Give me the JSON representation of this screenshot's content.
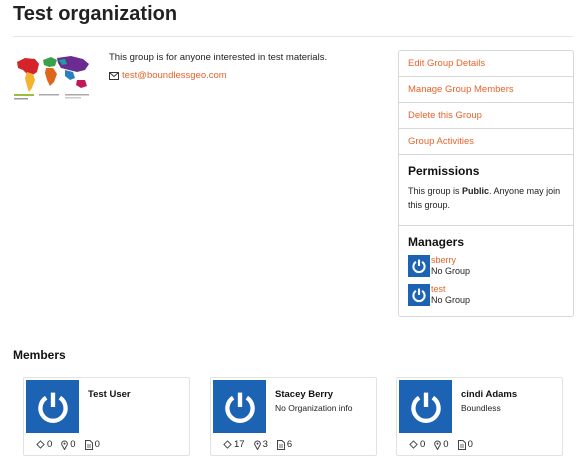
{
  "page": {
    "title": "Test organization"
  },
  "group": {
    "description": "This group is for anyone interested in test materials.",
    "email": "test@boundlessgeo.com"
  },
  "sidebar": {
    "links": [
      {
        "label": "Edit Group Details"
      },
      {
        "label": "Manage Group Members"
      },
      {
        "label": "Delete this Group"
      },
      {
        "label": "Group Activities"
      }
    ],
    "permissions": {
      "heading": "Permissions",
      "text_prefix": "This group is ",
      "text_bold": "Public",
      "text_suffix": ". Anyone may join this group."
    },
    "managers": {
      "heading": "Managers",
      "items": [
        {
          "username": "sberry",
          "group": "No Group"
        },
        {
          "username": "test",
          "group": "No Group"
        }
      ]
    }
  },
  "members": {
    "heading": "Members",
    "items": [
      {
        "name": "Test User",
        "org": "",
        "stats": [
          "0",
          "0",
          "0"
        ]
      },
      {
        "name": "Stacey Berry",
        "org": "No Organization info",
        "stats": [
          "17",
          "3",
          "6"
        ]
      },
      {
        "name": "cindi Adams",
        "org": "Boundless",
        "stats": [
          "0",
          "0",
          "0"
        ]
      }
    ]
  },
  "colors": {
    "accent": "#e8632a",
    "avatar": "#1d63b4"
  },
  "icons": {
    "email": "envelope-icon",
    "stat_layers": "diamond-icon",
    "stat_maps": "map-pin-icon",
    "stat_docs": "document-icon",
    "avatar": "power-icon"
  }
}
